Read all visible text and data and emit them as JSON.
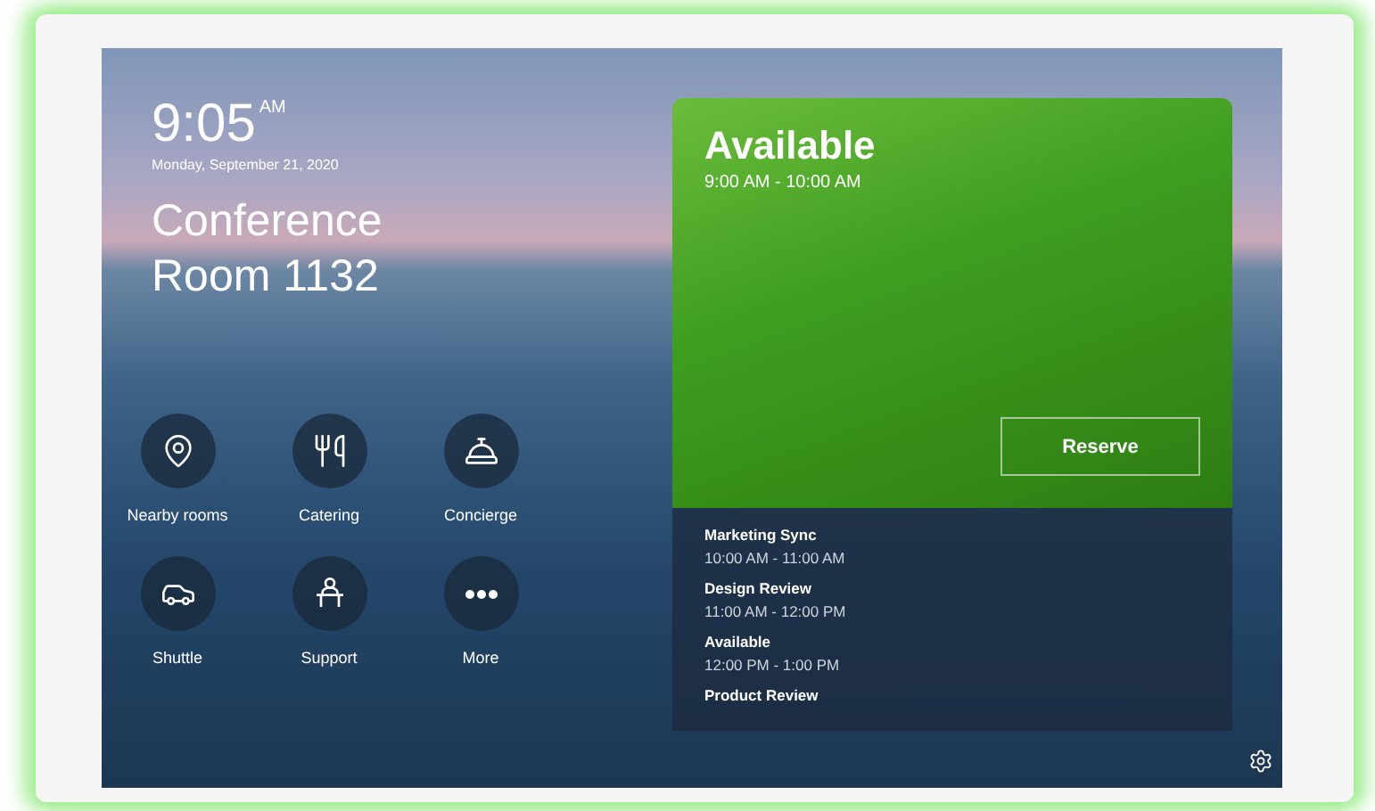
{
  "clock": {
    "time": "9:05",
    "meridiem": "AM",
    "date": "Monday, September 21, 2020"
  },
  "room": {
    "name": "Conference Room 1132"
  },
  "actions": [
    {
      "label": "Nearby rooms",
      "kind": "pin"
    },
    {
      "label": "Catering",
      "kind": "food"
    },
    {
      "label": "Concierge",
      "kind": "concierge"
    },
    {
      "label": "Shuttle",
      "kind": "car"
    },
    {
      "label": "Support",
      "kind": "support"
    },
    {
      "label": "More",
      "kind": "more"
    }
  ],
  "status": {
    "title": "Available",
    "time": "9:00 AM - 10:00 AM",
    "button": "Reserve",
    "available": true
  },
  "schedule": [
    {
      "title": "Marketing Sync",
      "time": "10:00 AM - 11:00 AM"
    },
    {
      "title": "Design Review",
      "time": "11:00 AM - 12:00 PM"
    },
    {
      "title": "Available",
      "time": "12:00 PM - 1:00 PM"
    },
    {
      "title": "Product Review"
    }
  ]
}
